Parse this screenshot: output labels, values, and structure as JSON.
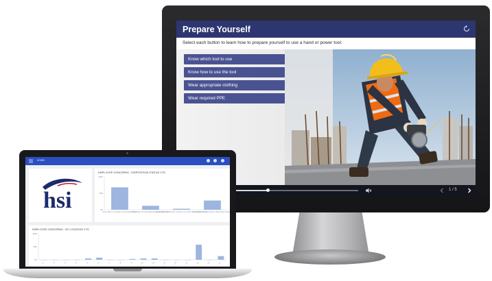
{
  "monitor": {
    "course": {
      "title": "Prepare Yourself",
      "instruction": "Select each button to learn how to prepare yourself to use a hand or power tool.",
      "options": [
        "Know which tool to use",
        "Know how to use the tool",
        "Wear appropriate clothing",
        "Wear required PPE"
      ],
      "photo": "construction-worker-cutting-tool",
      "player": {
        "progress": 0.3,
        "page_counter": "1 / 5"
      }
    }
  },
  "laptop": {
    "dashboard": {
      "header_title": "ADMIN",
      "logo_text": "hsi",
      "card1": {
        "title": "EMPLOYEE CONCERNS - DISPOSITION STATUS YTD"
      },
      "card2": {
        "title": "EMPLOYEE CONCERNS - BY LOCATION YTD"
      }
    }
  },
  "colors": {
    "course_title_bar": "#2d3670",
    "option_button": "#4a5392",
    "dashboard_header": "#2b4fc0",
    "dashboard_bar": "#9db5df",
    "hsi_navy": "#1d2b6b"
  },
  "chart_data": [
    {
      "type": "bar",
      "title": "EMPLOYEE CONCERNS - DISPOSITION STATUS YTD",
      "yticks": [
        "100%",
        "50%",
        "0%"
      ],
      "categories": [
        "Action Taken and Update Sent/Feedback Given",
        "Action Taken but with additional Information Needed",
        "Action Taken but not taken Location to be made Inconsistent/Unknown",
        "Action Taken and was Shared in Misconduct Guidelines"
      ],
      "values": [
        68,
        12,
        3,
        28
      ],
      "ylim": [
        0,
        100
      ]
    },
    {
      "type": "bar",
      "title": "EMPLOYEE CONCERNS - BY LOCATION YTD",
      "yticks": [
        "100%",
        "50%",
        "0%"
      ],
      "categories": [
        "L1",
        "L2",
        "L3",
        "L4",
        "L5",
        "L6",
        "L7",
        "L8",
        "L9",
        "L10",
        "L11",
        "L12",
        "L13",
        "L14",
        "L15",
        "L16",
        "L17"
      ],
      "values": [
        0,
        0,
        0,
        0,
        5,
        8,
        0,
        0,
        3,
        5,
        5,
        0,
        0,
        0,
        58,
        0,
        14
      ],
      "ylim": [
        0,
        100
      ]
    }
  ]
}
